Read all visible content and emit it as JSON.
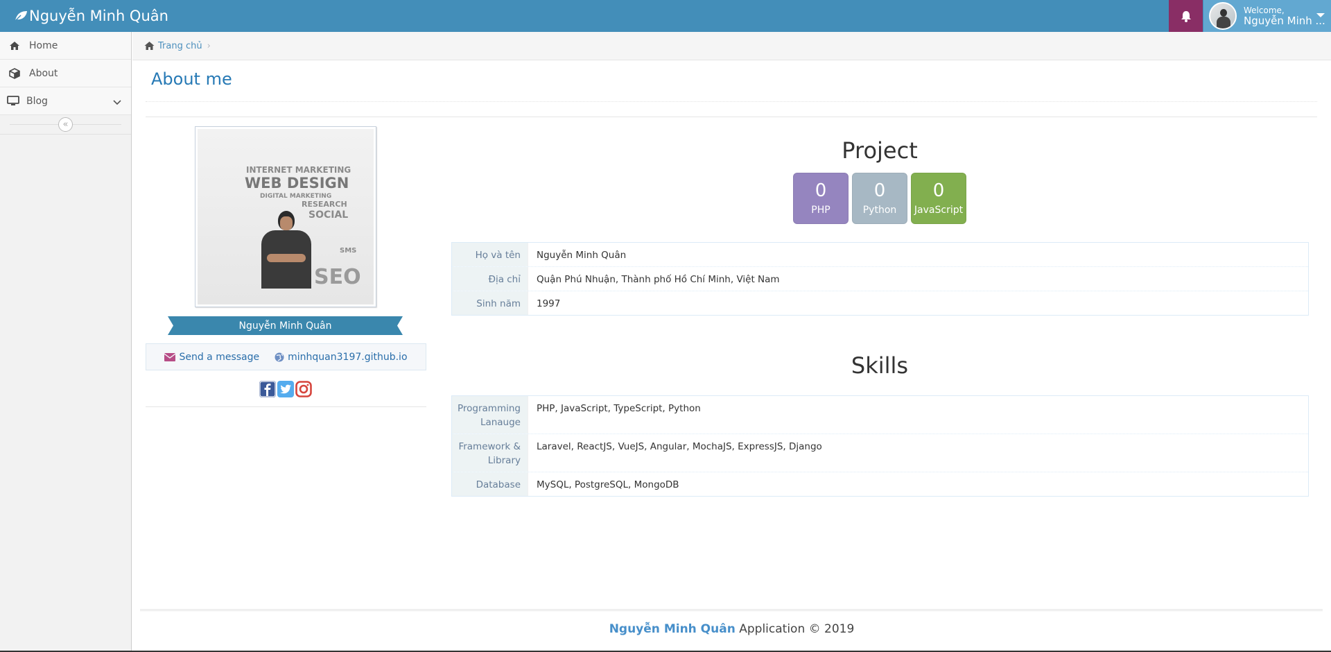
{
  "navbar": {
    "brand": "Nguyễn Minh Quân",
    "welcome": "Welcome,",
    "user_name": "Nguyễn Minh ..."
  },
  "sidebar": {
    "items": [
      {
        "label": "Home",
        "icon": "home-icon"
      },
      {
        "label": "About",
        "icon": "cube-icon"
      },
      {
        "label": "Blog",
        "icon": "desktop-icon"
      }
    ],
    "collapse_glyph": "«"
  },
  "breadcrumb": {
    "home_label": "Trang chủ"
  },
  "page": {
    "title": "About me"
  },
  "profile": {
    "name": "Nguyễn Minh Quân",
    "send_message": "Send a message",
    "website": "minhquan3197.github.io",
    "photo_words": [
      "INTERNET MARKETING",
      "WEB DESIGN",
      "DIGITAL MARKETING",
      "RESEARCH",
      "SOCIAL",
      "SEO",
      "SMS"
    ]
  },
  "project": {
    "title": "Project",
    "boxes": [
      {
        "count": "0",
        "label": "PHP",
        "color": "#9585bf"
      },
      {
        "count": "0",
        "label": "Python",
        "color": "#a7b8c4"
      },
      {
        "count": "0",
        "label": "JavaScript",
        "color": "#82af4f"
      }
    ]
  },
  "personal_info": [
    {
      "name": "Họ và tên",
      "value": "Nguyễn Minh Quân"
    },
    {
      "name": "Địa chỉ",
      "value": "Quận Phú Nhuận, Thành phố Hồ Chí Minh, Việt Nam"
    },
    {
      "name": "Sinh năm",
      "value": "1997"
    }
  ],
  "skills": {
    "title": "Skills",
    "rows": [
      {
        "name": "Programming Lanauge",
        "value": "PHP, JavaScript, TypeScript, Python"
      },
      {
        "name": "Framework & Library",
        "value": "Laravel, ReactJS, VueJS, Angular, MochaJS, ExpressJS, Django"
      },
      {
        "name": "Database",
        "value": "MySQL, PostgreSQL, MongoDB"
      }
    ]
  },
  "footer": {
    "name": "Nguyễn Minh Quân",
    "suffix": " Application © 2019"
  },
  "colors": {
    "navbar": "#438eb9",
    "bell": "#892e65",
    "user_area": "#62a8d1",
    "ribbon": "#3a87ad",
    "link": "#2a6eaa"
  }
}
